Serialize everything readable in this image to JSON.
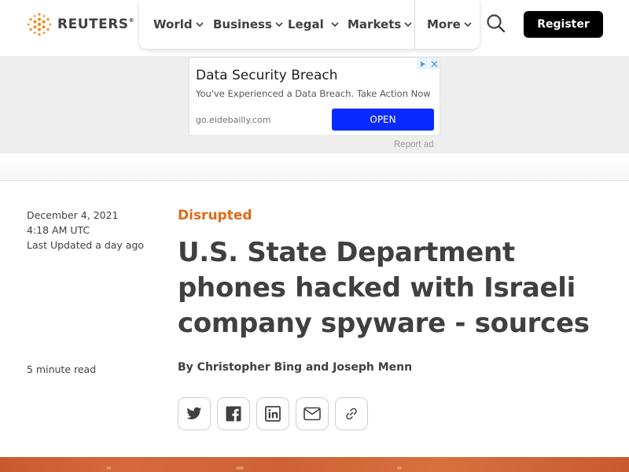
{
  "brand": {
    "name": "REUTERS",
    "reg_mark": "®",
    "accent_color": "#e06a16"
  },
  "nav": {
    "items": [
      {
        "label": "World"
      },
      {
        "label": "Business"
      },
      {
        "label": "Legal"
      },
      {
        "label": "Markets"
      },
      {
        "label": "More"
      }
    ],
    "search_icon": "search-icon",
    "register_label": "Register"
  },
  "ad": {
    "title": "Data Security Breach",
    "description": "You've Experienced a Data Breach. Take Action Now",
    "url": "go.eidebailly.com",
    "cta_label": "OPEN",
    "report_label": "Report ad",
    "cta_color": "#0a2bff"
  },
  "article": {
    "date": "December 4, 2021",
    "time": "4:18 AM UTC",
    "updated": "Last Updated a day ago",
    "read_time": "5 minute read",
    "section": "Disrupted",
    "headline": "U.S. State Department phones hacked with Israeli company spyware - sources",
    "byline_prefix": "By",
    "author_1": "Christopher Bing",
    "byline_conj": "and",
    "author_2": "Joseph Menn"
  },
  "share": {
    "icons": [
      "twitter-icon",
      "facebook-icon",
      "linkedin-icon",
      "email-icon",
      "link-icon"
    ]
  }
}
